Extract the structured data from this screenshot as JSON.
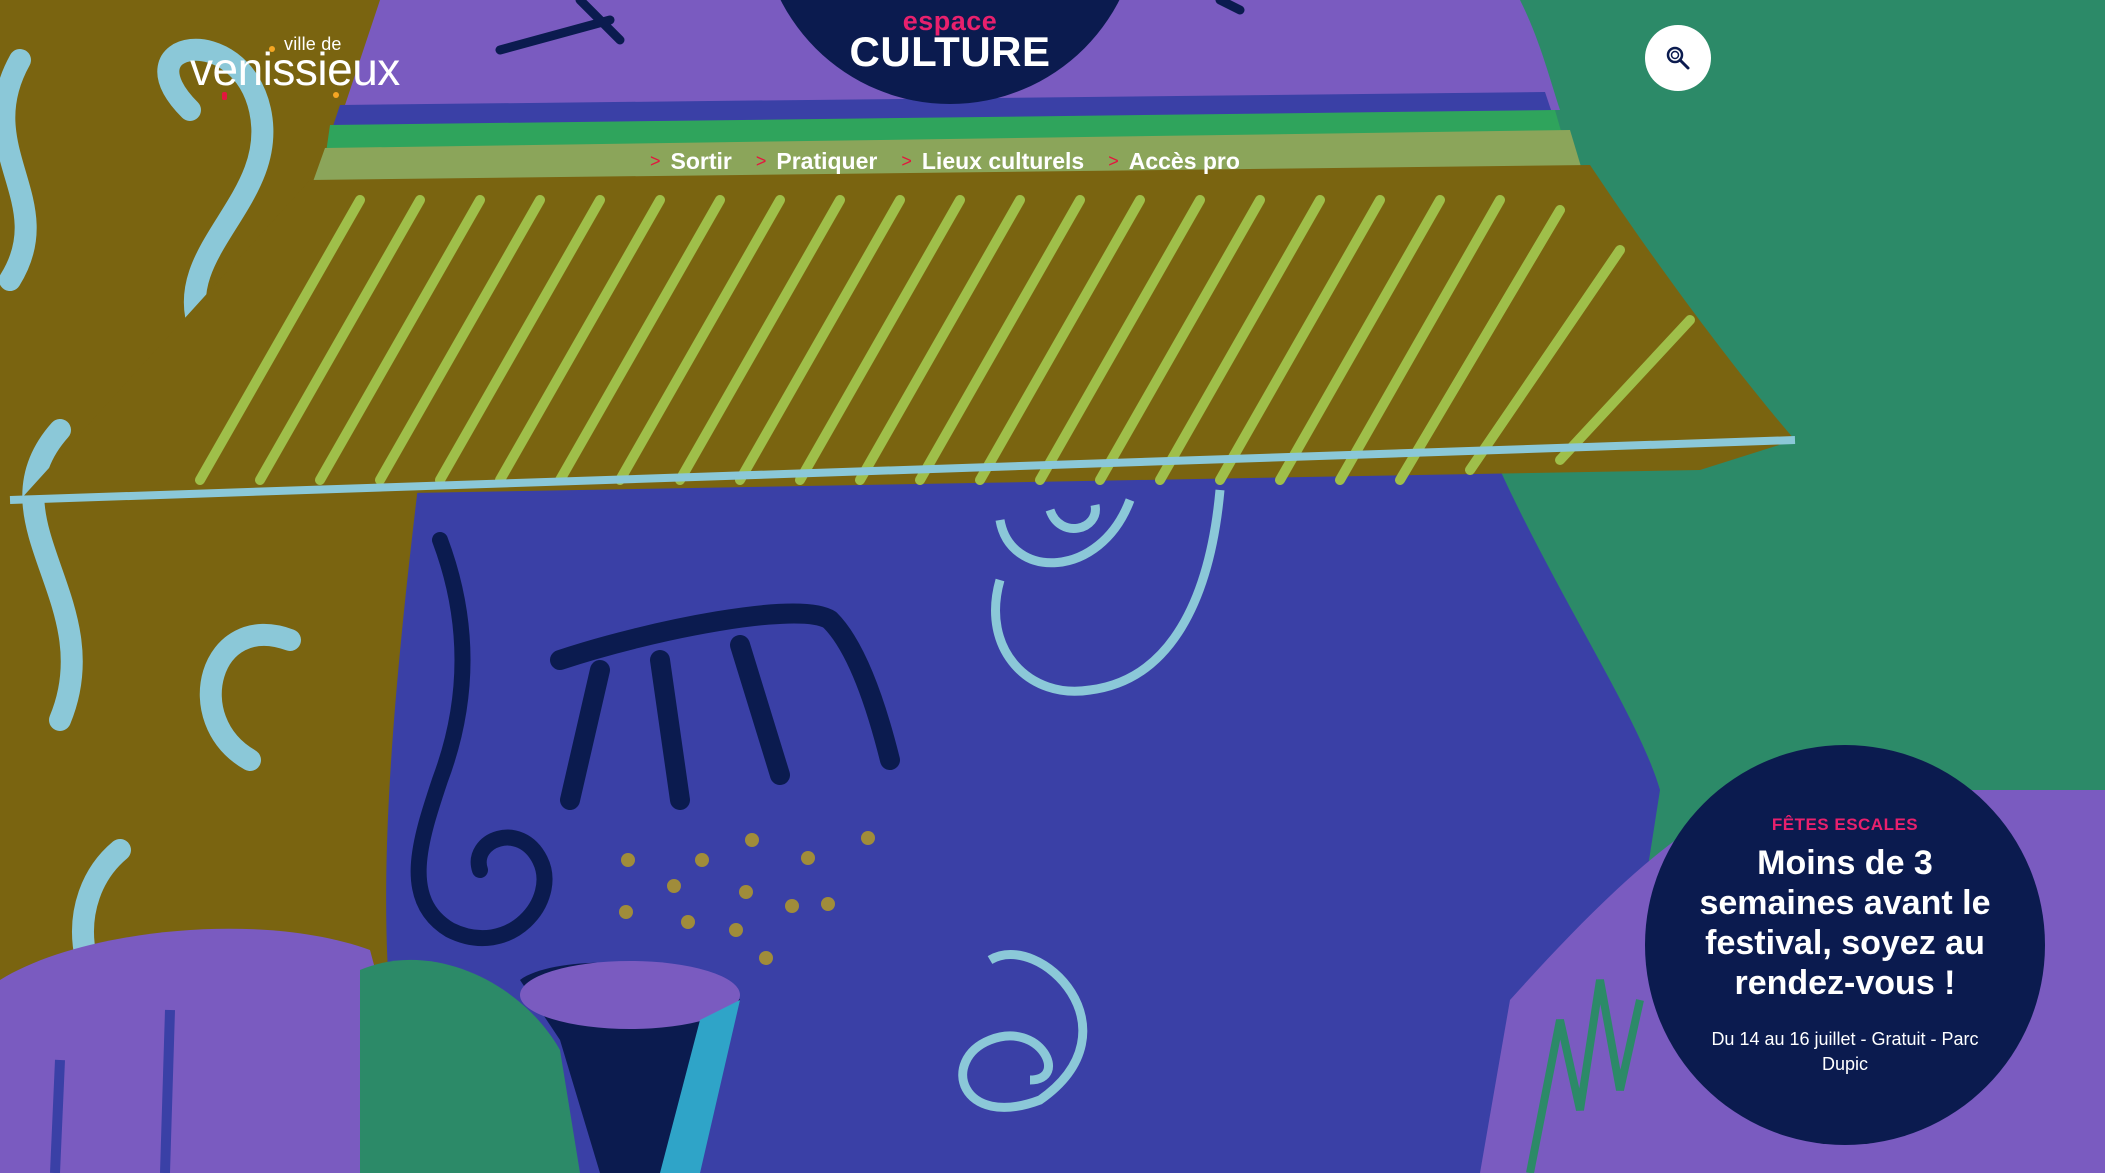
{
  "logo": {
    "small": "ville de",
    "big": "venissieux"
  },
  "emblem": {
    "small": "espace",
    "big": "CULTURE"
  },
  "search": {
    "icon": "search-icon"
  },
  "nav": {
    "chevron": ">",
    "items": [
      {
        "label": "Sortir"
      },
      {
        "label": "Pratiquer"
      },
      {
        "label": "Lieux culturels"
      },
      {
        "label": "Accès pro"
      }
    ]
  },
  "promo": {
    "kicker": "FÊTES ESCALES",
    "headline": "Moins de 3 semaines avant le festival, soyez au rendez-vous !",
    "details": "Du 14 au 16 juillet - Gratuit - Parc Dupic"
  },
  "colors": {
    "navy": "#0b1b4f",
    "pink": "#e8206d",
    "red": "#e3163e",
    "green": "#2c8a68",
    "blue": "#3a40a6",
    "purple": "#7a5bc0",
    "ochre": "#7a6410"
  }
}
